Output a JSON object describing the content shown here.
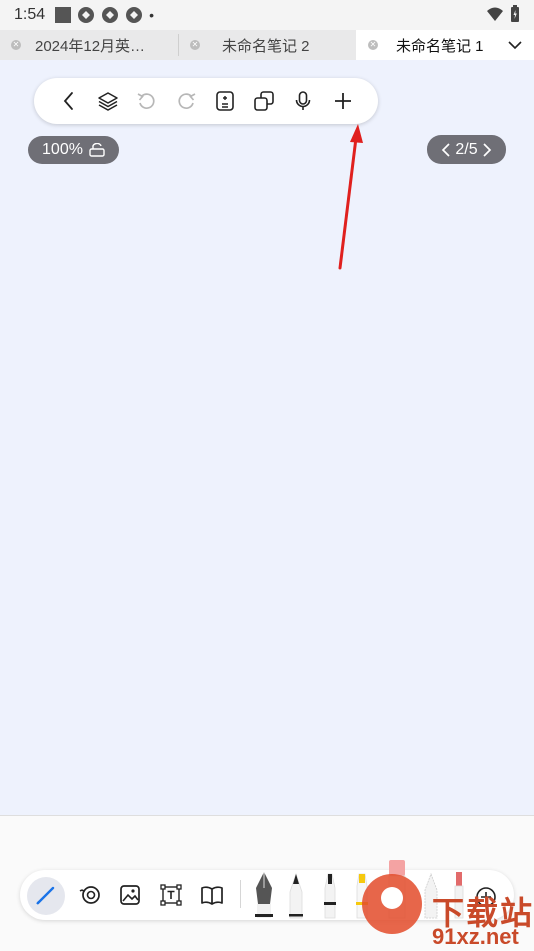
{
  "status_bar": {
    "time": "1:54",
    "dot": "•"
  },
  "tabs": [
    {
      "label": "2024年12月英…",
      "active": false
    },
    {
      "label": "未命名笔记 2",
      "active": false
    },
    {
      "label": "未命名笔记 1",
      "active": true
    }
  ],
  "toolbar": {
    "icons": [
      "back-icon",
      "layers-icon",
      "undo-icon",
      "redo-icon",
      "page-calc-icon",
      "copy-icon",
      "microphone-icon",
      "add-icon"
    ]
  },
  "zoom": {
    "label": "100%"
  },
  "pager": {
    "label": "2/5"
  },
  "bottom_tools": {
    "icons": [
      "pen-icon",
      "eraser-icon",
      "image-icon",
      "text-box-icon",
      "book-icon"
    ],
    "brushes": [
      "fountain-pen",
      "pencil",
      "marker",
      "highlighter",
      "eraser-brush",
      "crayon",
      "red-pen",
      "more-brushes"
    ]
  },
  "watermark": {
    "text_top": "下载站",
    "text_bottom": "91xz.net",
    "digit": "9"
  },
  "colors": {
    "canvas": "#eef2fd",
    "accent": "#1a73e8",
    "arrow": "#e0201e",
    "pill": "#6f6f76"
  }
}
